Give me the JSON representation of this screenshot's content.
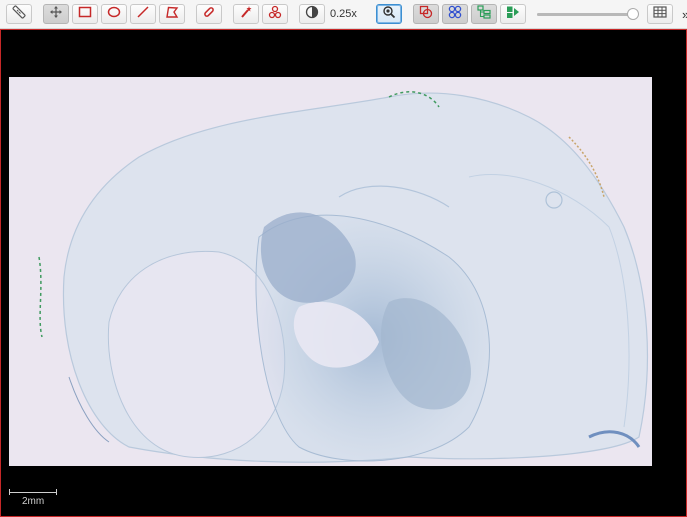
{
  "toolbar": {
    "tools": [
      {
        "name": "ruler-icon"
      },
      {
        "name": "pan-move-icon",
        "active": true
      },
      {
        "name": "rectangle-icon"
      },
      {
        "name": "ellipse-icon"
      },
      {
        "name": "line-icon"
      },
      {
        "name": "polygon-icon"
      },
      {
        "name": "link-icon"
      },
      {
        "name": "wand-icon"
      },
      {
        "name": "cells-icon"
      },
      {
        "name": "contrast-icon"
      }
    ],
    "zoom_label": "0.25x",
    "zoom_slider_fraction": 0.94,
    "more_label": "»"
  },
  "colors": {
    "viewer_border": "#c62828",
    "annotation_red": "#c62828",
    "accent_blue": "#2f6fcf",
    "accent_green": "#2a9d57",
    "slide_background": "#ebe6f0",
    "tissue_blue": "#aec4dc"
  },
  "viewer": {
    "scalebar_label": "2mm"
  }
}
